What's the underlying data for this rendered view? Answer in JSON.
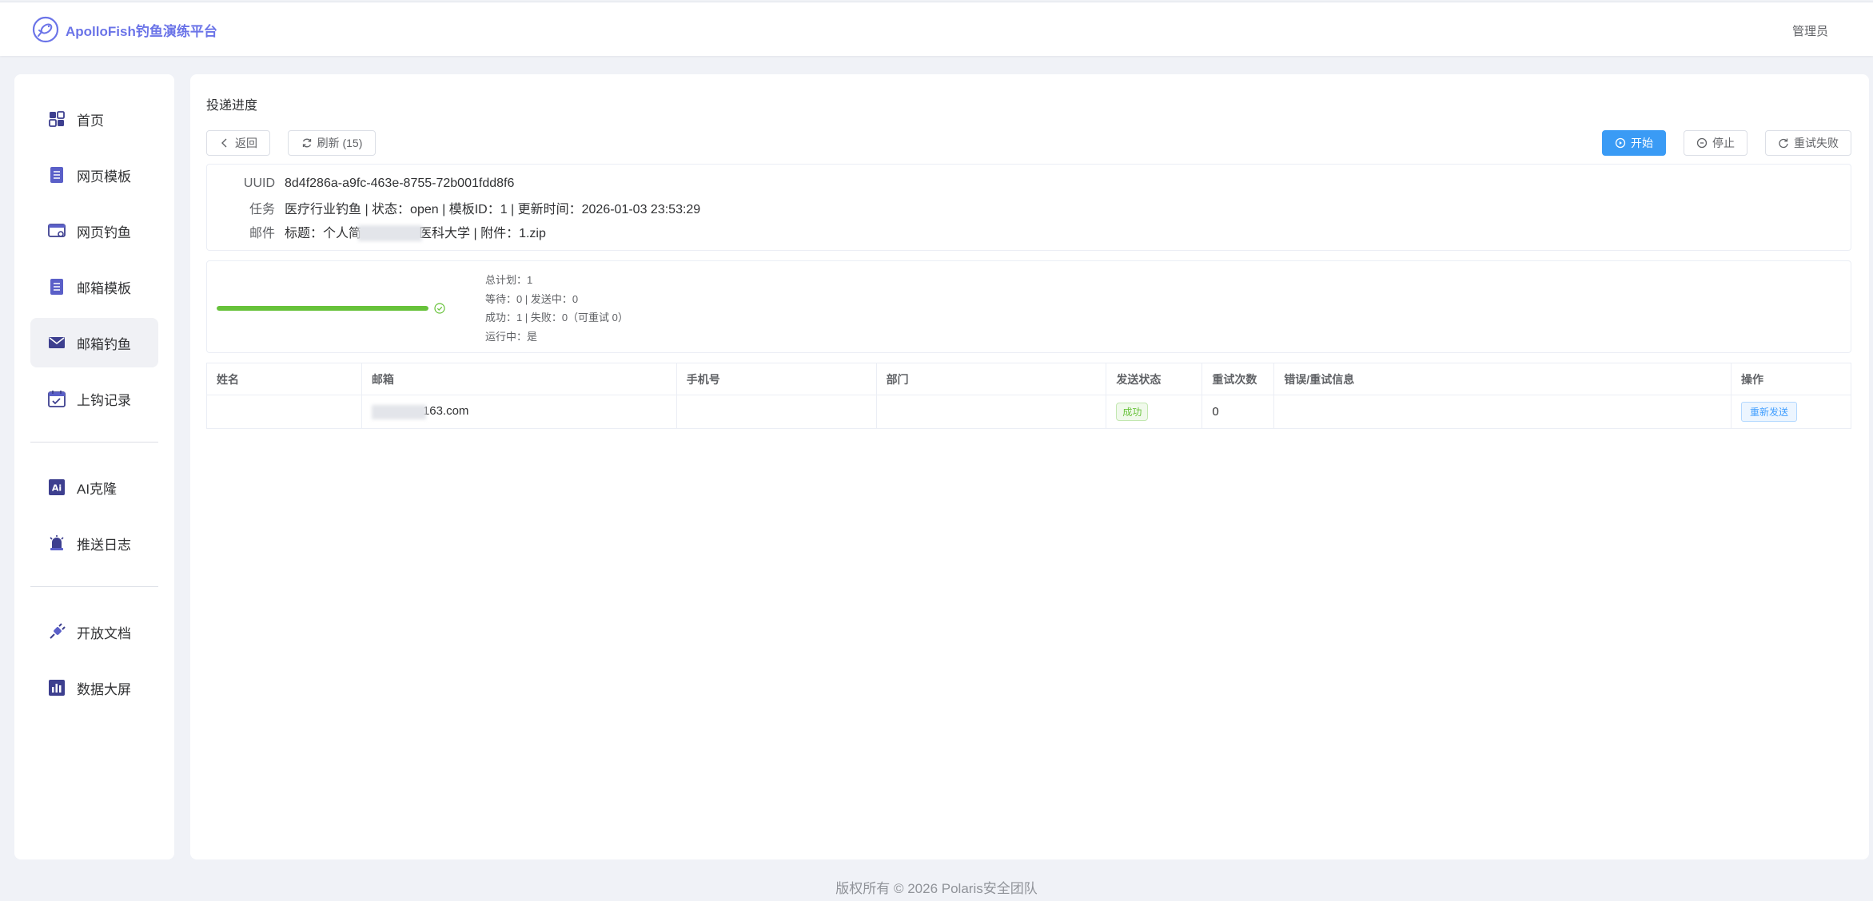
{
  "header": {
    "brand": "ApolloFish钓鱼演练平台",
    "user": "管理员",
    "brand_color": "#6b74e8"
  },
  "sidebar": {
    "items": [
      {
        "label": "首页",
        "icon": "grid-icon"
      },
      {
        "label": "网页模板",
        "icon": "document-icon"
      },
      {
        "label": "网页钓鱼",
        "icon": "browser-icon"
      },
      {
        "label": "邮箱模板",
        "icon": "document-icon"
      },
      {
        "label": "邮箱钓鱼",
        "icon": "mail-icon",
        "active": true
      },
      {
        "label": "上钩记录",
        "icon": "calendar-icon"
      },
      {
        "label": "AI克隆",
        "icon": "ai-icon"
      },
      {
        "label": "推送日志",
        "icon": "bell-icon"
      },
      {
        "label": "开放文档",
        "icon": "plug-icon"
      },
      {
        "label": "数据大屏",
        "icon": "chart-icon"
      }
    ]
  },
  "main": {
    "title": "投递进度",
    "toolbar": {
      "back": "返回",
      "refresh": "刷新 (15)",
      "start": "开始",
      "stop": "停止",
      "retry_failed": "重试失败"
    },
    "info": {
      "uuid_key": "UUID",
      "uuid_val": "8d4f286a-a9fc-463e-8755-72b001fdd8f6",
      "task_key": "任务",
      "task_val": "医疗行业钓鱼 | 状态：open | 模板ID：1 | 更新时间：2026-01-03 23:53:29",
      "mail_key": "邮件",
      "mail_val_prefix": "标题：个人简",
      "mail_val_suffix": "医科大学 | 附件：1.zip"
    },
    "progress": {
      "percent": 100,
      "stats": [
        "总计划：1",
        "等待：0 | 发送中：0",
        "成功：1 | 失败：0（可重试 0）",
        "运行中：是"
      ]
    },
    "table": {
      "columns": [
        "姓名",
        "邮箱",
        "手机号",
        "部门",
        "发送状态",
        "重试次数",
        "错误/重试信息",
        "操作"
      ],
      "rows": [
        {
          "name": "",
          "email_suffix": "163.com",
          "phone": "",
          "dept": "",
          "status": "成功",
          "retries": "0",
          "error": "",
          "action": "重新发送"
        }
      ]
    }
  },
  "footer": "版权所有 © 2026 Polaris安全团队",
  "colors": {
    "primary": "#3a9bf5",
    "success": "#67c23a",
    "nav_icon": "#5a5fc8"
  }
}
